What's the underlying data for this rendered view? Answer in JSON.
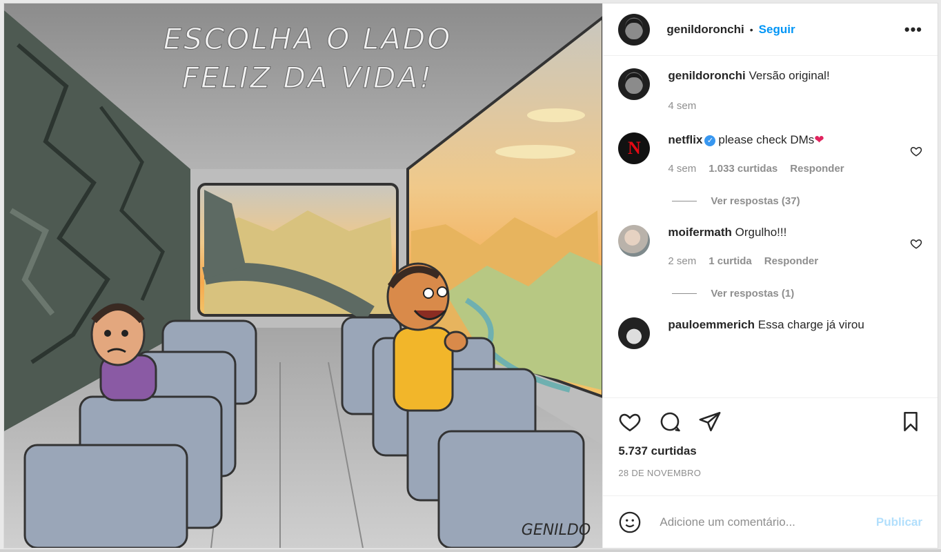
{
  "media": {
    "title_line1": "ESCOLHA O LADO",
    "title_line2": "FELIZ DA VIDA!",
    "signature": "GENILDO"
  },
  "header": {
    "username": "genildoronchi",
    "follow_label": "Seguir",
    "more_label": "•••"
  },
  "comments": [
    {
      "username": "genildoronchi",
      "text": "Versão original!",
      "time": "4 sem"
    },
    {
      "username": "netflix",
      "verified": "✓",
      "text": "please check DMs",
      "heart": "❤",
      "time": "4 sem",
      "likes": "1.033 curtidas",
      "reply": "Responder",
      "view_replies": "Ver respostas (37)"
    },
    {
      "username": "moifermath",
      "text": "Orgulho!!!",
      "time": "2 sem",
      "likes": "1 curtida",
      "reply": "Responder",
      "view_replies": "Ver respostas (1)"
    },
    {
      "username": "pauloemmerich",
      "text": "Essa charge já virou"
    }
  ],
  "actions": {
    "icons": [
      "heart-icon",
      "comment-icon",
      "share-icon",
      "bookmark-icon"
    ]
  },
  "likes_count": "5.737 curtidas",
  "date": "28 DE NOVEMBRO",
  "add_comment": {
    "placeholder": "Adicione um comentário...",
    "publish_label": "Publicar"
  },
  "colors": {
    "accent": "#0095f6",
    "publish_disabled": "#b2dffc",
    "netflix_red": "#e50914"
  }
}
